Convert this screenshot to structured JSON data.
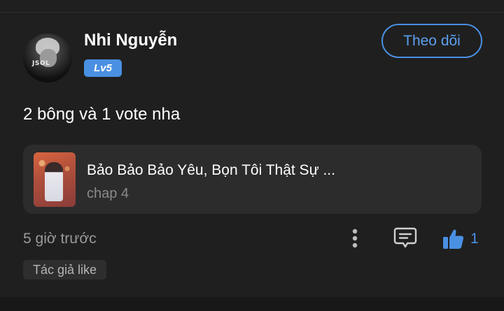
{
  "comment": {
    "user": {
      "name": "Nhi Nguyễn",
      "level": "Lv5",
      "avatar_text": "JSOL"
    },
    "follow_label": "Theo dõi",
    "text": "2 bông và 1 vote nha",
    "chapter": {
      "title": "Bảo Bảo Bảo Yêu, Bọn Tôi Thật Sự ...",
      "subtitle": "chap 4"
    },
    "time": "5 giờ trước",
    "like_count": "1",
    "author_tag": "Tác giả like",
    "icons": {
      "more": "more-vertical-icon",
      "reply": "comment-icon",
      "like": "thumbs-up-icon"
    }
  },
  "colors": {
    "background": "#1f1f1f",
    "accent": "#4a90e2",
    "card": "#2c2c2c",
    "muted": "#8a8a8a"
  }
}
